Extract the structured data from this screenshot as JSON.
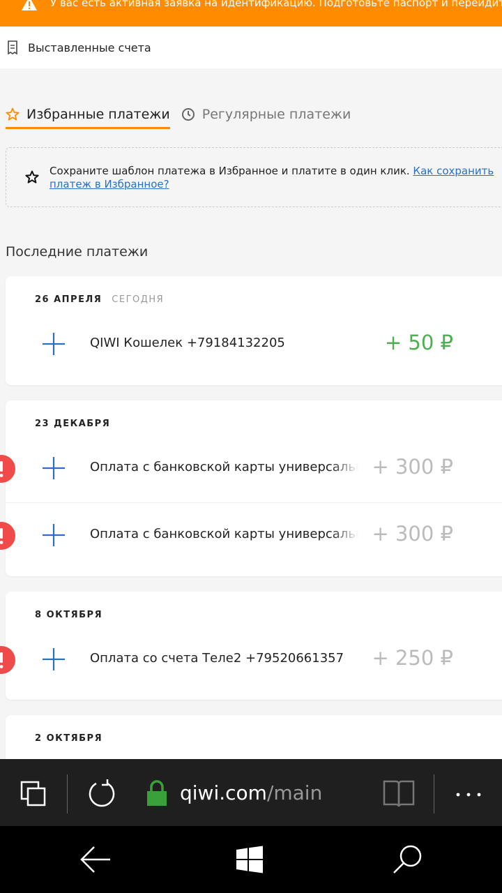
{
  "warning": {
    "text": "У вас есть активная заявка на идентификацию. Подготовьте паспорт и перейдите по кнопке"
  },
  "invoices": {
    "label": "Выставленные счета"
  },
  "tabs": [
    {
      "label": "Избранные платежи"
    },
    {
      "label": "Регулярные платежи"
    }
  ],
  "hint": {
    "text": "Сохраните шаблон платежа в Избранное и платите в один клик. ",
    "link": "Как сохранить платеж в Избранное?"
  },
  "recent": {
    "title": "Последние платежи",
    "groups": [
      {
        "date": "26 АПРЕЛЯ",
        "badge": "СЕГОДНЯ",
        "items": [
          {
            "name": "QIWI Кошелек +79184132205",
            "amount": "+ 50 ₽"
          }
        ]
      },
      {
        "date": "23 ДЕКАБРЯ",
        "items": [
          {
            "name": "Оплата с банковской карты универсальная",
            "amount": "+ 300 ₽"
          },
          {
            "name": "Оплата с банковской карты универсальная",
            "amount": "+ 300 ₽"
          }
        ]
      },
      {
        "date": "8 ОКТЯБРЯ",
        "items": [
          {
            "name": "Оплата со счета Теле2 +79520661357",
            "amount": "+ 250 ₽"
          }
        ]
      },
      {
        "date": "2 ОКТЯБРЯ",
        "items": []
      }
    ]
  },
  "browser": {
    "domain": "qiwi.com",
    "path": "/main"
  },
  "colors": {
    "accent": "#ff8c00",
    "link": "#2b6fc2",
    "success": "#4caf50",
    "error": "#ef4b4b",
    "plus": "#2b6fc2"
  },
  "icons": [
    "warning-icon",
    "receipt-icon",
    "star-outline-icon",
    "clock-icon",
    "plus-icon",
    "error-icon",
    "tabs-icon",
    "refresh-icon",
    "lock-icon",
    "reading-view-icon",
    "more-icon",
    "back-arrow-icon",
    "windows-icon",
    "search-icon"
  ]
}
